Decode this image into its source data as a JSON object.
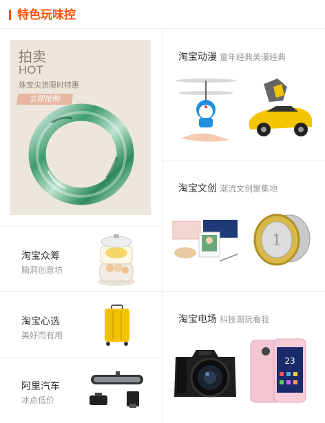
{
  "header": {
    "title": "特色玩味控"
  },
  "auction": {
    "title": "拍卖",
    "hot": "HOT",
    "subtitle": "珠宝尖货限时特惠",
    "button": "立即抢购"
  },
  "left_items": [
    {
      "title": "淘宝众筹",
      "subtitle": "脑洞创意坊"
    },
    {
      "title": "淘宝心选",
      "subtitle": "美好而有用"
    },
    {
      "title": "阿里汽车",
      "subtitle": "冰点低价"
    }
  ],
  "right_items": [
    {
      "title": "淘宝动漫",
      "subtitle": "童年经典美漫经典"
    },
    {
      "title": "淘宝文创",
      "subtitle": "潮流文创聚集地"
    },
    {
      "title": "淘宝电场",
      "subtitle": "科技潮玩看我"
    }
  ],
  "phone_screen_text": "23"
}
